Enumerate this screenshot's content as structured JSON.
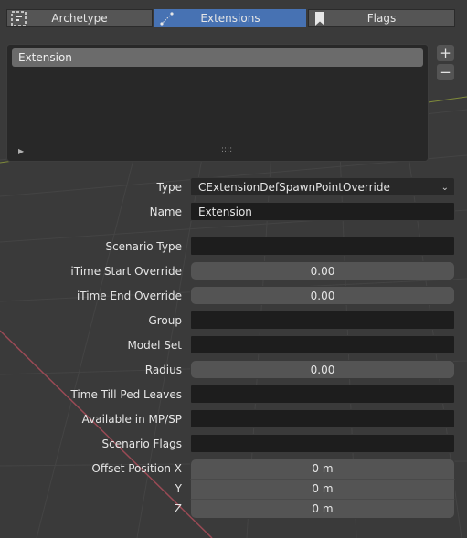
{
  "tabs": [
    {
      "label": "Archetype",
      "icon": "archetype-icon",
      "active": false
    },
    {
      "label": "Extensions",
      "icon": "extensions-icon",
      "active": true
    },
    {
      "label": "Flags",
      "icon": "bookmark-icon",
      "active": false
    }
  ],
  "list": {
    "items": [
      "Extension"
    ],
    "add_label": "+",
    "remove_label": "−",
    "expand_glyph": "▶",
    "resize_glyph": "::::"
  },
  "properties": {
    "type": {
      "label": "Type",
      "value": "CExtensionDefSpawnPointOverride",
      "chevron": "⌄"
    },
    "name": {
      "label": "Name",
      "value": "Extension"
    },
    "scenario_type": {
      "label": "Scenario Type",
      "value": ""
    },
    "itime_start": {
      "label": "iTime Start Override",
      "value": "0.00"
    },
    "itime_end": {
      "label": "iTime End Override",
      "value": "0.00"
    },
    "group": {
      "label": "Group",
      "value": ""
    },
    "model_set": {
      "label": "Model Set",
      "value": ""
    },
    "radius": {
      "label": "Radius",
      "value": "0.00"
    },
    "time_till_ped_leaves": {
      "label": "Time Till Ped Leaves",
      "value": ""
    },
    "available_mp_sp": {
      "label": "Available in MP/SP",
      "value": ""
    },
    "scenario_flags": {
      "label": "Scenario Flags",
      "value": ""
    },
    "offset_position": {
      "label": "Offset Position X",
      "y_label": "Y",
      "z_label": "Z",
      "x": "0 m",
      "y": "0 m",
      "z": "0 m"
    }
  },
  "colors": {
    "accent": "#4772b3",
    "panel": "#282828",
    "field_dark": "#1d1d1d",
    "field_num": "#545454",
    "grid_line_green": "#7f8a3a",
    "grid_line_red": "#9a4a55"
  }
}
